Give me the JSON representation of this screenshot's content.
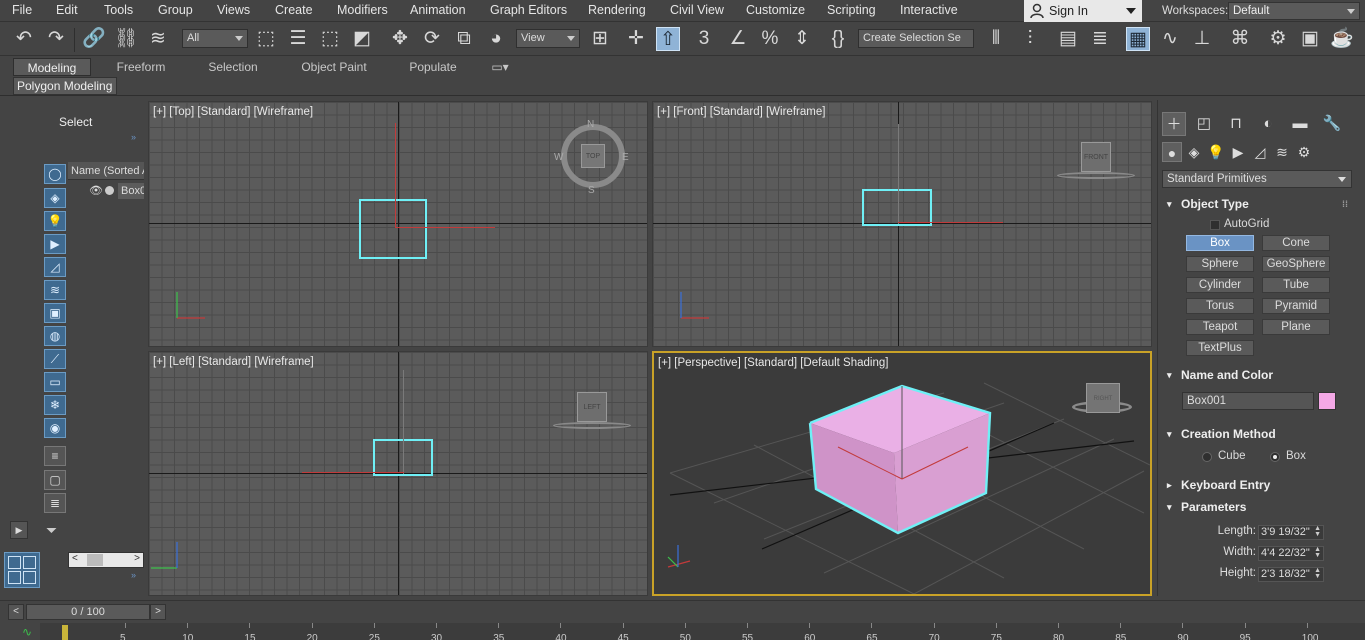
{
  "menu": {
    "items": [
      "File",
      "Edit",
      "Tools",
      "Group",
      "Views",
      "Create",
      "Modifiers",
      "Animation",
      "Graph Editors",
      "Rendering",
      "Civil View",
      "Customize",
      "Scripting",
      "Interactive"
    ],
    "sign_in": "Sign In",
    "workspaces_label": "Workspaces:",
    "workspace_value": "Default"
  },
  "toolbar": {
    "selection_filter": "All",
    "ref_coord": "View",
    "create_selection_set": "Create Selection Se",
    "snap_value": "3"
  },
  "ribbon": {
    "tabs": [
      "Modeling",
      "Freeform",
      "Selection",
      "Object Paint",
      "Populate"
    ],
    "active_tab": "Modeling",
    "panel_label": "Polygon Modeling"
  },
  "scene_explorer": {
    "select_label": "Select",
    "column_header": "Name (Sorted A",
    "object_name": "Box0"
  },
  "viewports": {
    "top": {
      "label": "[+] [Top] [Standard] [Wireframe]",
      "cube": "TOP",
      "compass": {
        "n": "N",
        "s": "S",
        "e": "E",
        "w": "W"
      }
    },
    "front": {
      "label": "[+] [Front] [Standard] [Wireframe]",
      "cube": "FRONT"
    },
    "left": {
      "label": "[+] [Left] [Standard] [Wireframe]",
      "cube": "LEFT"
    },
    "perspective": {
      "label": "[+] [Perspective] [Standard] [Default Shading]",
      "cube": "RIGHT"
    }
  },
  "command_panel": {
    "category": "Standard Primitives",
    "object_type": {
      "title": "Object Type",
      "autogrid": "AutoGrid",
      "buttons": [
        "Box",
        "Cone",
        "Sphere",
        "GeoSphere",
        "Cylinder",
        "Tube",
        "Torus",
        "Pyramid",
        "Teapot",
        "Plane",
        "TextPlus"
      ],
      "active": "Box"
    },
    "name_color": {
      "title": "Name and Color",
      "name": "Box001",
      "color": "#f4a8e6"
    },
    "creation_method": {
      "title": "Creation Method",
      "cube": "Cube",
      "box": "Box",
      "selected": "Box"
    },
    "keyboard_entry": {
      "title": "Keyboard Entry"
    },
    "parameters": {
      "title": "Parameters",
      "length_label": "Length:",
      "length": "3'9 19/32\"",
      "width_label": "Width:",
      "width": "4'4 22/32\"",
      "height_label": "Height:",
      "height": "2'3 18/32\""
    }
  },
  "timeline": {
    "frame": "0 / 100",
    "prev": "<",
    "next": ">",
    "ticks": [
      "5",
      "10",
      "15",
      "20",
      "25",
      "30",
      "35",
      "40",
      "45",
      "50",
      "55",
      "60",
      "65",
      "70",
      "75",
      "80",
      "85",
      "90",
      "95",
      "100"
    ]
  },
  "colors": {
    "accent_blue": "#6a93c4",
    "selection_cyan": "#6ff0f6",
    "box_pink": "#e9a5e1",
    "active_viewport_border": "#c9a227"
  }
}
